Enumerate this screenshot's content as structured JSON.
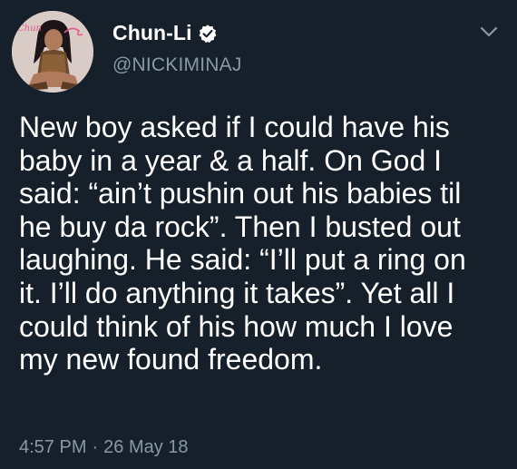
{
  "tweet": {
    "display_name": "Chun-Li",
    "handle": "@NICKIMINAJ",
    "text_lines": [
      "New boy asked if I could have his",
      "baby in a year & a half. On God I",
      "said: “ain’t pushin out his babies til",
      "he buy da rock”. Then I busted out",
      "laughing. He said: “I’ll put a ring on",
      "it. I’ll do anything it takes”. Yet all I",
      "could think of his how much I love",
      "my new found freedom."
    ],
    "time": "4:57 PM",
    "separator": "·",
    "date": "26 May 18",
    "avatar_signature": "Chun"
  },
  "icons": {
    "verified": "verified-badge-icon",
    "menu": "chevron-down-icon"
  },
  "colors": {
    "background": "#15202b",
    "text_primary": "#ffffff",
    "text_secondary": "#8899a6",
    "avatar_accent": "#e05a8a"
  }
}
